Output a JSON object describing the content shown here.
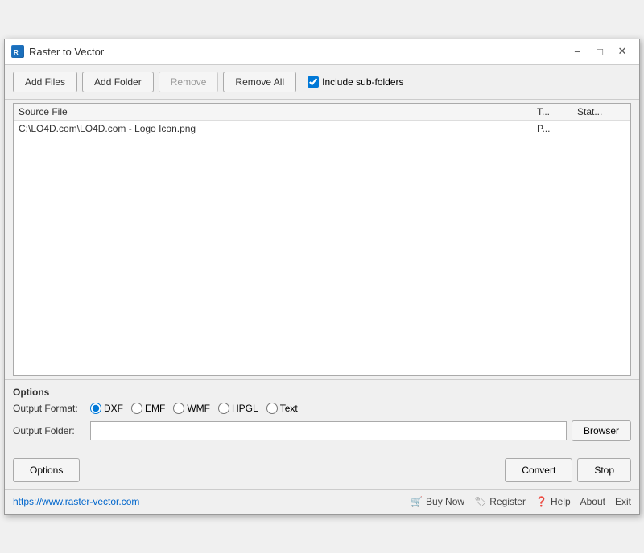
{
  "window": {
    "title": "Raster to Vector",
    "icon": "R2V"
  },
  "title_controls": {
    "minimize": "−",
    "maximize": "□",
    "close": "✕"
  },
  "toolbar": {
    "add_files": "Add Files",
    "add_folder": "Add Folder",
    "remove": "Remove",
    "remove_all": "Remove All",
    "include_subfolders": "Include sub-folders",
    "include_subfolders_checked": true
  },
  "file_list": {
    "header": {
      "source_file": "Source File",
      "type": "T...",
      "status": "Stat..."
    },
    "rows": [
      {
        "source": "C:\\LO4D.com\\LO4D.com - Logo Icon.png",
        "type": "P...",
        "status": ""
      }
    ]
  },
  "options": {
    "section_label": "Options",
    "output_format_label": "Output Format:",
    "formats": [
      {
        "id": "dxf",
        "label": "DXF",
        "selected": true
      },
      {
        "id": "emf",
        "label": "EMF",
        "selected": false
      },
      {
        "id": "wmf",
        "label": "WMF",
        "selected": false
      },
      {
        "id": "hpgl",
        "label": "HPGL",
        "selected": false
      },
      {
        "id": "text",
        "label": "Text",
        "selected": false
      }
    ],
    "output_folder_label": "Output Folder:",
    "output_folder_value": "",
    "output_folder_placeholder": "",
    "browser_button": "Browser"
  },
  "bottom": {
    "options_button": "Options",
    "convert_button": "Convert",
    "stop_button": "Stop"
  },
  "status_bar": {
    "link": "https://www.raster-vector.com",
    "buy_now": "Buy Now",
    "register": "Register",
    "help": "Help",
    "about": "About",
    "exit": "Exit"
  }
}
